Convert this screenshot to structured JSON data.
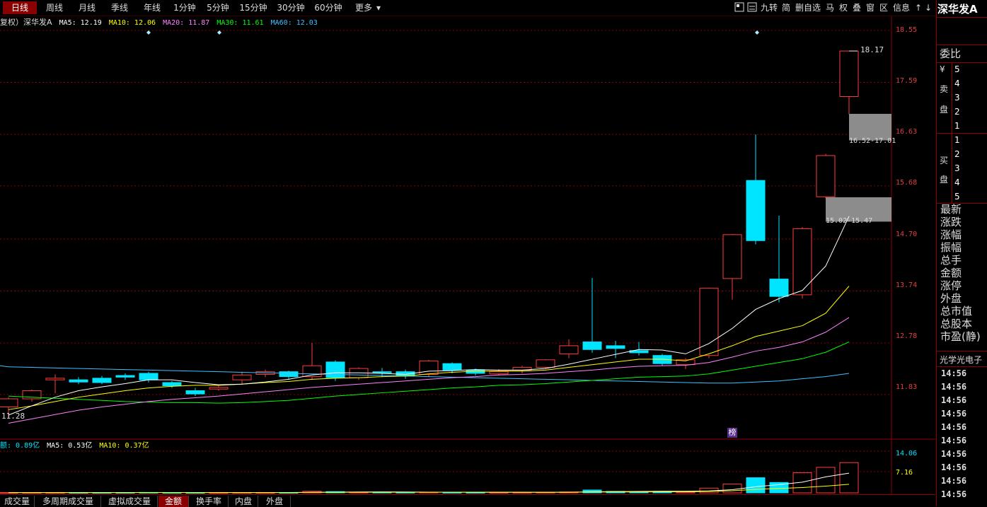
{
  "toolbar": {
    "period_tabs": [
      "日线",
      "周线",
      "月线",
      "季线",
      "年线",
      "1分钟",
      "5分钟",
      "15分钟",
      "30分钟",
      "60分钟",
      "更多"
    ],
    "active_tab": "日线",
    "tools": [
      "九转",
      "简",
      "删自选",
      "马",
      "权",
      "叠",
      "窗",
      "区",
      "信息"
    ]
  },
  "legend": {
    "prefix": "复权）深华发A",
    "ma5": "MA5: 12.19",
    "ma10": "MA10: 12.06",
    "ma20": "MA20: 11.87",
    "ma30": "MA30: 11.61",
    "ma60": "MA60: 12.03"
  },
  "colors": {
    "up": "#ff3b3b",
    "down": "#00e5ff",
    "ma5": "#ffffff",
    "ma10": "#ffff00",
    "ma20": "#ff80ff",
    "ma30": "#00ff00",
    "ma60": "#40c0ff",
    "grid": "#8b0000"
  },
  "price_axis": [
    "18.55",
    "17.59",
    "16.63",
    "15.68",
    "14.70",
    "13.74",
    "12.78",
    "11.83"
  ],
  "annotations": {
    "high": "18.17",
    "low": "11.28",
    "zone_upper": "16.52-17.01",
    "zone_lower": "15.02-15.47",
    "badge": "榜"
  },
  "volume": {
    "legend_amount": "额: 0.89亿",
    "legend_ma5": "MA5: 0.53亿",
    "legend_ma10": "MA10: 0.37亿",
    "axis": [
      "14.06",
      "7.16"
    ]
  },
  "chart_data": {
    "type": "candlestick",
    "ylim": [
      11.28,
      18.55
    ],
    "candles": [
      {
        "o": 11.6,
        "c": 11.75,
        "h": 11.78,
        "l": 11.4
      },
      {
        "o": 11.75,
        "c": 11.9,
        "h": 11.92,
        "l": 11.7
      },
      {
        "o": 12.1,
        "c": 12.13,
        "h": 12.2,
        "l": 11.85
      },
      {
        "o": 12.1,
        "c": 12.06,
        "h": 12.15,
        "l": 12.02
      },
      {
        "o": 12.13,
        "c": 12.05,
        "h": 12.17,
        "l": 12.02
      },
      {
        "o": 12.18,
        "c": 12.15,
        "h": 12.22,
        "l": 12.1
      },
      {
        "o": 12.22,
        "c": 12.1,
        "h": 12.25,
        "l": 12.05
      },
      {
        "o": 12.05,
        "c": 11.99,
        "h": 12.08,
        "l": 11.95
      },
      {
        "o": 11.9,
        "c": 11.84,
        "h": 11.95,
        "l": 11.8
      },
      {
        "o": 11.93,
        "c": 11.96,
        "h": 11.99,
        "l": 11.9
      },
      {
        "o": 12.1,
        "c": 12.19,
        "h": 12.25,
        "l": 12.02
      },
      {
        "o": 12.2,
        "c": 12.25,
        "h": 12.29,
        "l": 12.15
      },
      {
        "o": 12.25,
        "c": 12.16,
        "h": 12.27,
        "l": 12.1
      },
      {
        "o": 12.16,
        "c": 12.36,
        "h": 12.78,
        "l": 12.1
      },
      {
        "o": 12.43,
        "c": 12.14,
        "h": 12.46,
        "l": 12.08
      },
      {
        "o": 12.14,
        "c": 12.31,
        "h": 12.33,
        "l": 12.1
      },
      {
        "o": 12.25,
        "c": 12.23,
        "h": 12.32,
        "l": 12.15
      },
      {
        "o": 12.25,
        "c": 12.17,
        "h": 12.29,
        "l": 12.12
      },
      {
        "o": 12.2,
        "c": 12.45,
        "h": 12.47,
        "l": 12.15
      },
      {
        "o": 12.4,
        "c": 12.28,
        "h": 12.42,
        "l": 12.22
      },
      {
        "o": 12.28,
        "c": 12.22,
        "h": 12.31,
        "l": 12.18
      },
      {
        "o": 12.21,
        "c": 12.25,
        "h": 12.3,
        "l": 12.18
      },
      {
        "o": 12.28,
        "c": 12.33,
        "h": 12.36,
        "l": 12.22
      },
      {
        "o": 12.33,
        "c": 12.47,
        "h": 12.48,
        "l": 12.3
      },
      {
        "o": 12.58,
        "c": 12.73,
        "h": 12.85,
        "l": 12.5
      },
      {
        "o": 12.8,
        "c": 12.66,
        "h": 13.98,
        "l": 12.6
      },
      {
        "o": 12.73,
        "c": 12.68,
        "h": 12.82,
        "l": 12.5
      },
      {
        "o": 12.64,
        "c": 12.6,
        "h": 12.8,
        "l": 12.55
      },
      {
        "o": 12.55,
        "c": 12.4,
        "h": 12.58,
        "l": 12.36
      },
      {
        "o": 12.38,
        "c": 12.47,
        "h": 12.5,
        "l": 12.3
      },
      {
        "o": 12.55,
        "c": 13.79,
        "h": 13.8,
        "l": 12.5
      },
      {
        "o": 13.97,
        "c": 14.78,
        "h": 14.79,
        "l": 13.58
      },
      {
        "o": 15.78,
        "c": 14.67,
        "h": 16.63,
        "l": 14.6
      },
      {
        "o": 13.96,
        "c": 13.64,
        "h": 15.13,
        "l": 13.53
      },
      {
        "o": 13.67,
        "c": 14.89,
        "h": 14.92,
        "l": 13.6
      },
      {
        "o": 15.48,
        "c": 16.24,
        "h": 16.27,
        "l": 15.45
      },
      {
        "o": 17.33,
        "c": 18.17,
        "h": 18.17,
        "l": 17.0
      }
    ],
    "ma5": [
      11.45,
      11.62,
      11.78,
      11.9,
      11.97,
      12.03,
      12.1,
      12.1,
      12.05,
      12.01,
      12.02,
      12.06,
      12.11,
      12.19,
      12.23,
      12.23,
      12.22,
      12.2,
      12.26,
      12.27,
      12.29,
      12.28,
      12.28,
      12.31,
      12.39,
      12.48,
      12.57,
      12.66,
      12.65,
      12.58,
      12.77,
      13.05,
      13.4,
      13.6,
      13.75,
      14.2,
      15.12
    ],
    "ma10": [
      11.55,
      11.62,
      11.7,
      11.78,
      11.84,
      11.9,
      11.95,
      11.98,
      12.0,
      12.0,
      12.02,
      12.05,
      12.07,
      12.11,
      12.13,
      12.14,
      12.16,
      12.17,
      12.21,
      12.24,
      12.26,
      12.26,
      12.26,
      12.28,
      12.33,
      12.38,
      12.43,
      12.48,
      12.48,
      12.45,
      12.58,
      12.73,
      12.9,
      13.0,
      13.1,
      13.33,
      13.83
    ],
    "ma20": [
      11.3,
      11.38,
      11.46,
      11.54,
      11.6,
      11.65,
      11.7,
      11.74,
      11.77,
      11.8,
      11.84,
      11.88,
      11.92,
      11.96,
      11.99,
      12.02,
      12.05,
      12.08,
      12.11,
      12.14,
      12.16,
      12.19,
      12.2,
      12.22,
      12.25,
      12.28,
      12.32,
      12.35,
      12.36,
      12.37,
      12.42,
      12.52,
      12.63,
      12.7,
      12.8,
      12.98,
      13.25
    ],
    "ma30": [
      11.8,
      11.78,
      11.76,
      11.74,
      11.72,
      11.7,
      11.69,
      11.68,
      11.68,
      11.67,
      11.68,
      11.7,
      11.72,
      11.76,
      11.8,
      11.83,
      11.86,
      11.89,
      11.92,
      11.95,
      11.97,
      12.0,
      12.01,
      12.03,
      12.06,
      12.09,
      12.12,
      12.15,
      12.16,
      12.17,
      12.21,
      12.28,
      12.35,
      12.42,
      12.49,
      12.61,
      12.8
    ],
    "ma60": [
      12.34,
      12.33,
      12.32,
      12.31,
      12.3,
      12.29,
      12.28,
      12.27,
      12.26,
      12.25,
      12.24,
      12.23,
      12.22,
      12.21,
      12.2,
      12.19,
      12.18,
      12.17,
      12.16,
      12.15,
      12.14,
      12.13,
      12.12,
      12.11,
      12.1,
      12.09,
      12.08,
      12.07,
      12.06,
      12.05,
      12.04,
      12.04,
      12.06,
      12.08,
      12.12,
      12.16,
      12.22
    ],
    "volume": [
      0.1,
      0.12,
      0.12,
      0.1,
      0.1,
      0.12,
      0.15,
      0.08,
      0.08,
      0.08,
      0.12,
      0.1,
      0.12,
      0.55,
      0.42,
      0.22,
      0.2,
      0.18,
      0.24,
      0.16,
      0.15,
      0.16,
      0.17,
      0.2,
      0.3,
      0.95,
      0.5,
      0.4,
      0.5,
      0.3,
      1.6,
      3.0,
      5.1,
      3.5,
      6.8,
      8.6,
      10.2
    ],
    "vol_ma5": [
      0.1,
      0.1,
      0.1,
      0.1,
      0.1,
      0.11,
      0.12,
      0.11,
      0.1,
      0.1,
      0.1,
      0.1,
      0.1,
      0.2,
      0.25,
      0.3,
      0.32,
      0.3,
      0.25,
      0.2,
      0.18,
      0.18,
      0.18,
      0.18,
      0.2,
      0.36,
      0.42,
      0.47,
      0.53,
      0.53,
      0.66,
      1.06,
      2.06,
      2.78,
      3.6,
      5.4,
      6.64
    ],
    "vol_ma10": [
      0.1,
      0.1,
      0.1,
      0.1,
      0.1,
      0.1,
      0.11,
      0.11,
      0.11,
      0.11,
      0.11,
      0.11,
      0.11,
      0.15,
      0.18,
      0.2,
      0.21,
      0.21,
      0.22,
      0.23,
      0.23,
      0.23,
      0.23,
      0.22,
      0.22,
      0.26,
      0.29,
      0.31,
      0.34,
      0.35,
      0.49,
      0.72,
      1.2,
      1.48,
      1.8,
      2.26,
      2.88
    ],
    "vol_ylim": [
      0,
      14.06
    ]
  },
  "sidebar": {
    "title": "深华发A",
    "weibi": "委比",
    "sell_label": [
      "¥",
      "卖",
      "盘"
    ],
    "sell_levels": [
      "5",
      "4",
      "3",
      "2",
      "1"
    ],
    "buy_label": [
      "买",
      "盘"
    ],
    "buy_levels": [
      "1",
      "2",
      "3",
      "4",
      "5"
    ],
    "fields": [
      "最新",
      "涨跌",
      "涨幅",
      "振幅",
      "总手",
      "金额",
      "涨停",
      "外盘",
      "总市值",
      "总股本",
      "市盈(静)"
    ],
    "concept": "光学光电子",
    "times": [
      "14:56",
      "14:56",
      "14:56",
      "14:56",
      "14:56",
      "14:56",
      "14:56",
      "14:56",
      "14:56",
      "14:56"
    ]
  },
  "bottom_tabs": {
    "items": [
      "成交量",
      "多周期成交量",
      "虚拟成交量",
      "金额",
      "换手率",
      "内盘",
      "外盘"
    ],
    "active": "金额"
  }
}
